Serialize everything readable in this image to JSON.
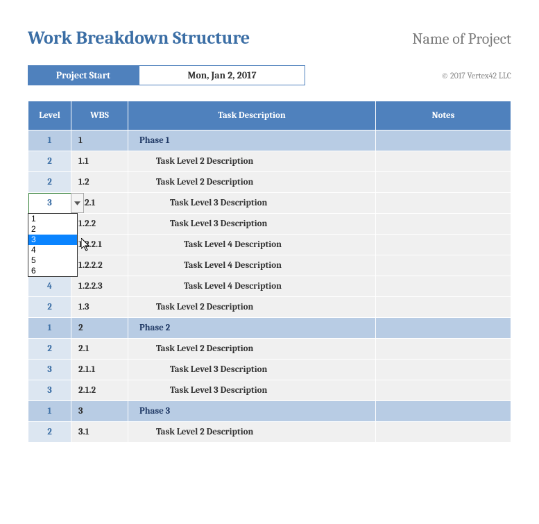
{
  "title": "Work Breakdown Structure",
  "project_name": "Name of Project",
  "start": {
    "label": "Project Start",
    "date": "Mon, Jan 2, 2017"
  },
  "copyright": "© 2017 Vertex42 LLC",
  "columns": {
    "level": "Level",
    "wbs": "WBS",
    "desc": "Task Description",
    "notes": "Notes"
  },
  "rows": [
    {
      "level": "1",
      "wbs": "1",
      "desc": "Phase 1",
      "indent": 1,
      "phase": true
    },
    {
      "level": "2",
      "wbs": "1.1",
      "desc": "Task Level 2 Description",
      "indent": 2,
      "phase": false
    },
    {
      "level": "2",
      "wbs": "1.2",
      "desc": "Task Level 2 Description",
      "indent": 2,
      "phase": false
    },
    {
      "level": "3",
      "wbs": "1.2.1",
      "desc": "Task Level 3 Description",
      "indent": 3,
      "phase": false,
      "selected": true
    },
    {
      "level": "",
      "wbs": "1.2.2",
      "desc": "Task Level 3 Description",
      "indent": 3,
      "phase": false
    },
    {
      "level": "",
      "wbs": "1.2.2.1",
      "desc": "Task Level 4 Description",
      "indent": 4,
      "phase": false
    },
    {
      "level": "",
      "wbs": "1.2.2.2",
      "desc": "Task Level 4 Description",
      "indent": 4,
      "phase": false
    },
    {
      "level": "4",
      "wbs": "1.2.2.3",
      "desc": "Task Level 4 Description",
      "indent": 4,
      "phase": false
    },
    {
      "level": "2",
      "wbs": "1.3",
      "desc": "Task Level 2 Description",
      "indent": 2,
      "phase": false
    },
    {
      "level": "1",
      "wbs": "2",
      "desc": "Phase 2",
      "indent": 1,
      "phase": true
    },
    {
      "level": "2",
      "wbs": "2.1",
      "desc": "Task Level 2 Description",
      "indent": 2,
      "phase": false
    },
    {
      "level": "3",
      "wbs": "2.1.1",
      "desc": "Task Level 3 Description",
      "indent": 3,
      "phase": false
    },
    {
      "level": "3",
      "wbs": "2.1.2",
      "desc": "Task Level 3 Description",
      "indent": 3,
      "phase": false
    },
    {
      "level": "1",
      "wbs": "3",
      "desc": "Phase 3",
      "indent": 1,
      "phase": true
    },
    {
      "level": "2",
      "wbs": "3.1",
      "desc": "Task Level 2 Description",
      "indent": 2,
      "phase": false
    }
  ],
  "dropdown": {
    "options": [
      "1",
      "2",
      "3",
      "4",
      "5",
      "6"
    ],
    "selected": "3"
  }
}
